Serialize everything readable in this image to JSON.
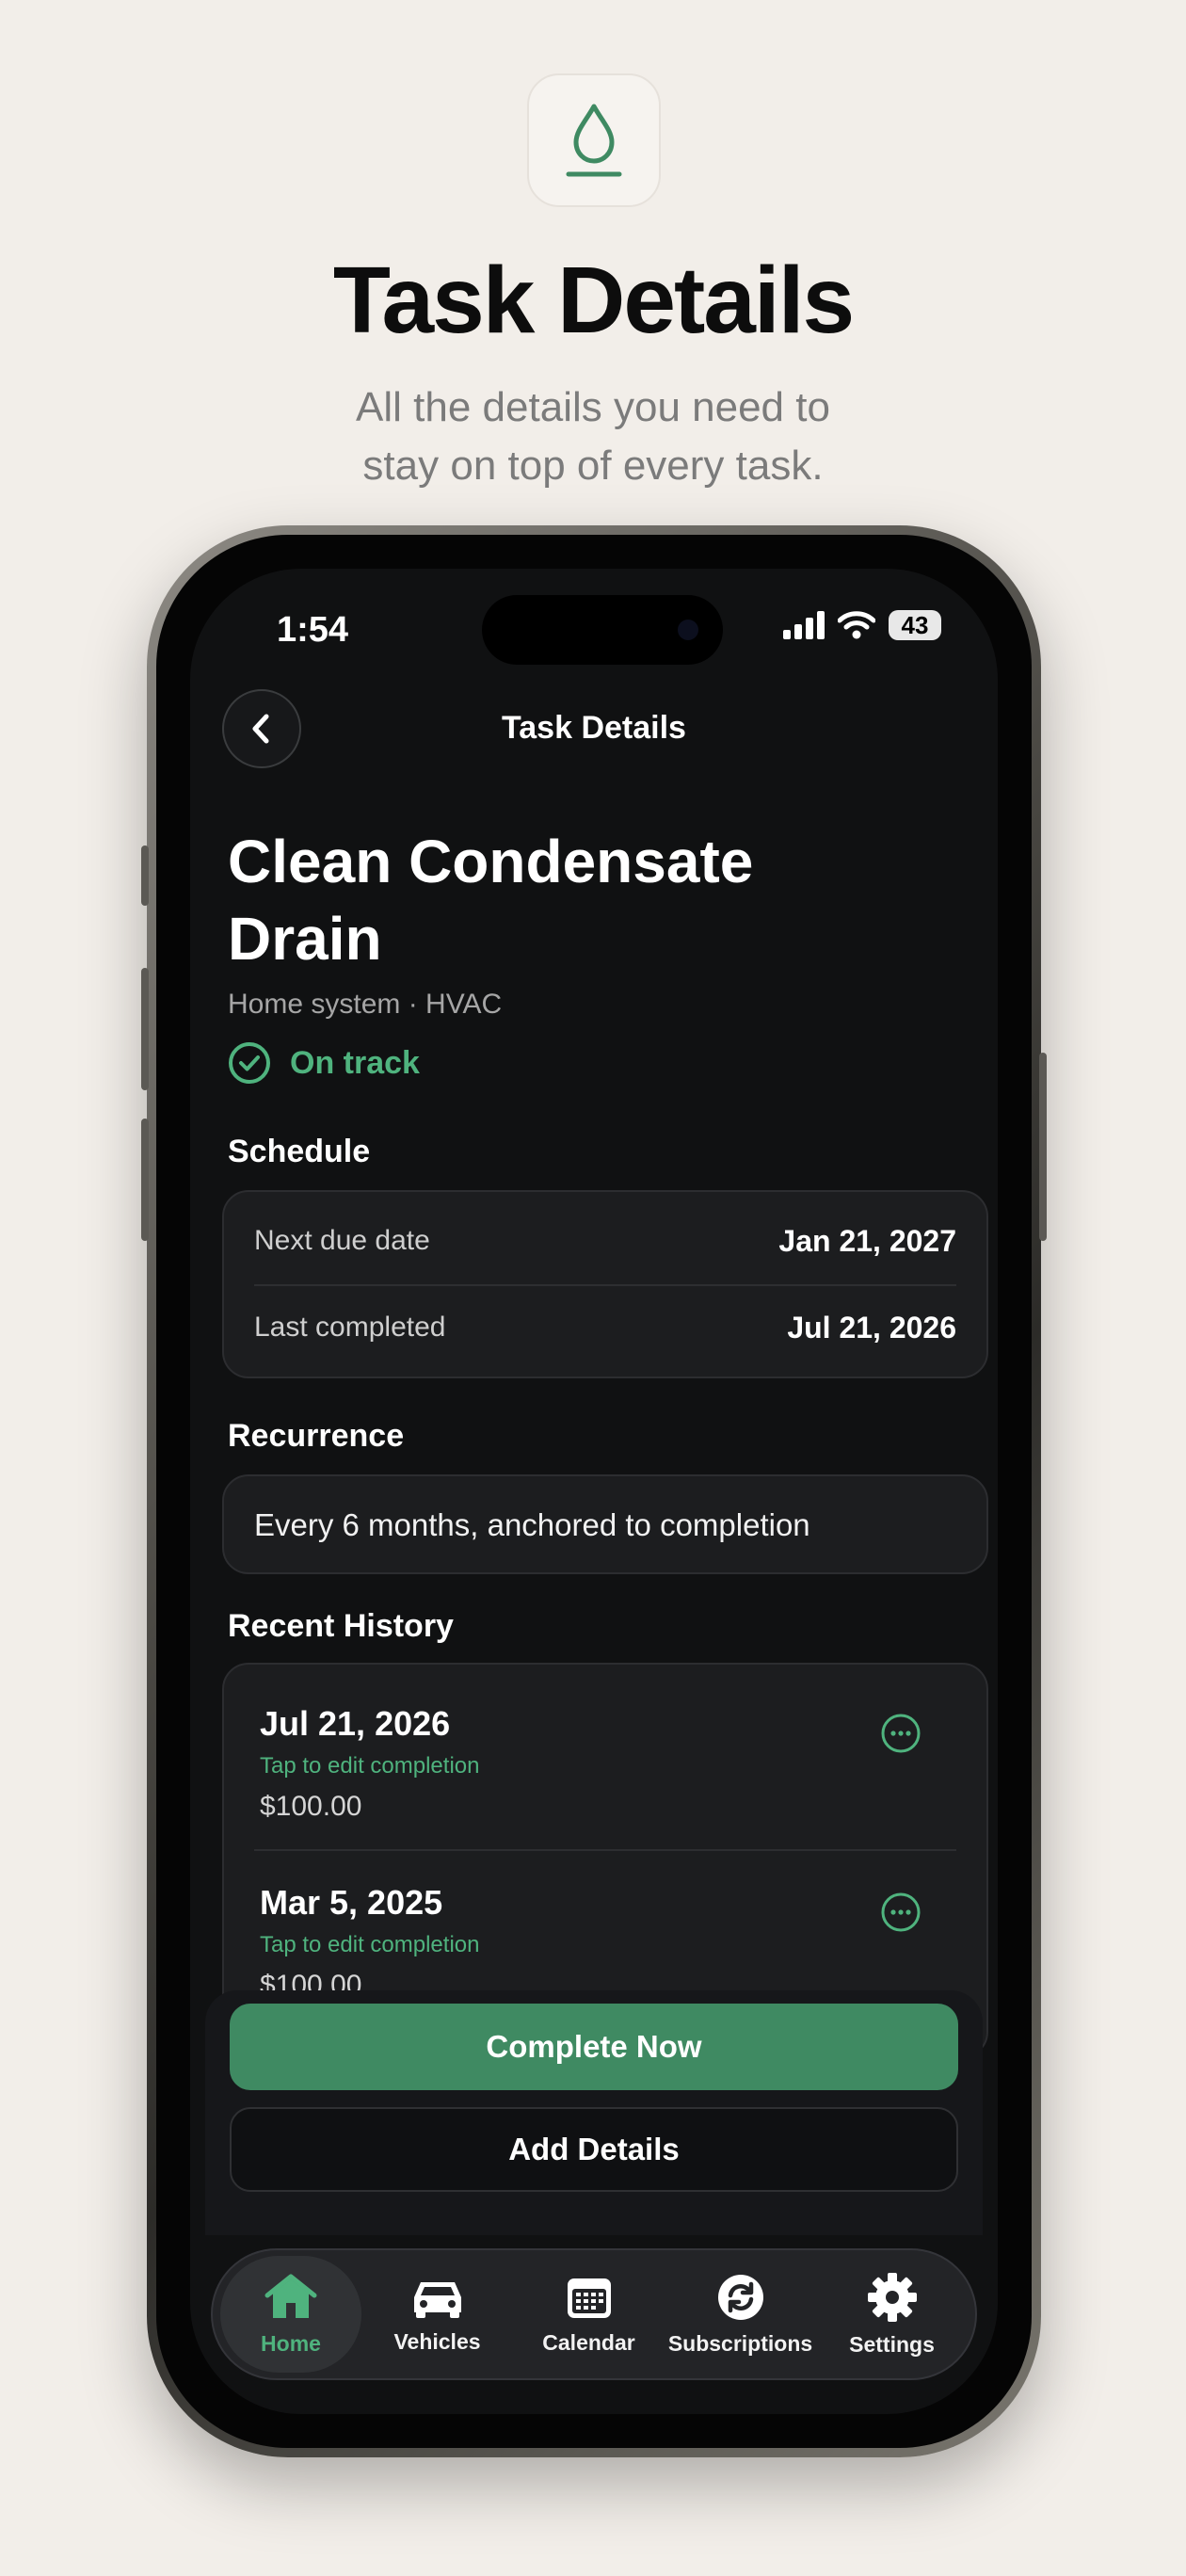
{
  "header": {
    "icon_name": "water-drop-icon",
    "title": "Task Details",
    "subtitle_line1": "All the details you need to",
    "subtitle_line2": "stay on top of every task."
  },
  "status_bar": {
    "time": "1:54",
    "battery": "43"
  },
  "nav": {
    "title": "Task Details"
  },
  "task": {
    "title_line1": "Clean Condensate",
    "title_line2": "Drain",
    "meta": "Home system · HVAC",
    "status": "On track"
  },
  "schedule": {
    "label": "Schedule",
    "rows": [
      {
        "label": "Next due date",
        "value": "Jan 21, 2027"
      },
      {
        "label": "Last completed",
        "value": "Jul 21, 2026"
      }
    ]
  },
  "recurrence": {
    "label": "Recurrence",
    "text": "Every 6 months, anchored to completion"
  },
  "history": {
    "label": "Recent History",
    "items": [
      {
        "date": "Jul 21, 2026",
        "hint": "Tap to edit completion",
        "amount": "$100.00"
      },
      {
        "date": "Mar 5, 2025",
        "hint": "Tap to edit completion",
        "amount": "$100.00"
      }
    ]
  },
  "actions": {
    "primary": "Complete Now",
    "secondary": "Add Details"
  },
  "tabs": [
    {
      "label": "Home",
      "icon": "home-icon",
      "active": true
    },
    {
      "label": "Vehicles",
      "icon": "car-icon",
      "active": false
    },
    {
      "label": "Calendar",
      "icon": "calendar-icon",
      "active": false
    },
    {
      "label": "Subscriptions",
      "icon": "refresh-icon",
      "active": false
    },
    {
      "label": "Settings",
      "icon": "gear-icon",
      "active": false
    }
  ],
  "colors": {
    "accent": "#4fb37e",
    "primary_button": "#3f8a62",
    "screen_bg": "#101112",
    "page_bg": "#f2eee9"
  }
}
